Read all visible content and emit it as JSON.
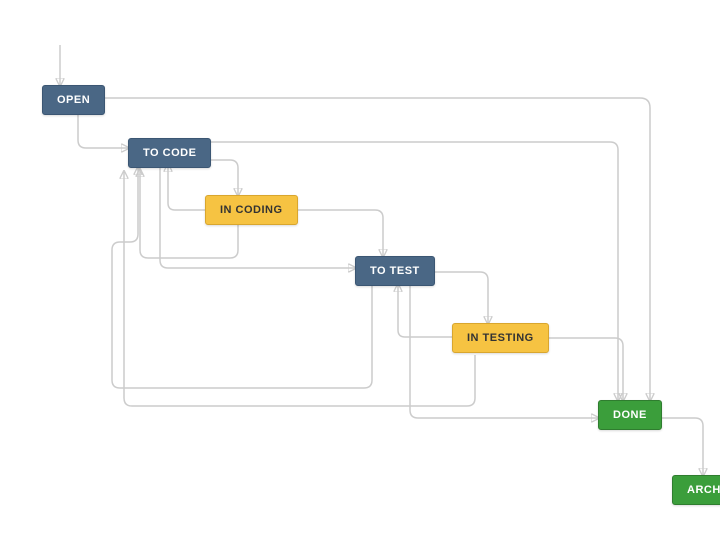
{
  "nodes": {
    "open": {
      "label": "OPEN",
      "type": "blue"
    },
    "to_code": {
      "label": "TO CODE",
      "type": "blue"
    },
    "in_coding": {
      "label": "IN CODING",
      "type": "yellow"
    },
    "to_test": {
      "label": "TO TEST",
      "type": "blue"
    },
    "in_testing": {
      "label": "IN TESTING",
      "type": "yellow"
    },
    "done": {
      "label": "DONE",
      "type": "green"
    },
    "archived": {
      "label": "ARCHI",
      "type": "green"
    }
  },
  "colors": {
    "blue": "#4a6785",
    "yellow": "#f6c342",
    "green": "#3b9e3b",
    "edge": "#cccccc"
  },
  "transitions": [
    [
      "open",
      "to_code"
    ],
    [
      "open",
      "done"
    ],
    [
      "to_code",
      "in_coding"
    ],
    [
      "to_code",
      "to_test"
    ],
    [
      "to_code",
      "done"
    ],
    [
      "in_coding",
      "to_code"
    ],
    [
      "in_coding",
      "to_test"
    ],
    [
      "to_test",
      "to_code"
    ],
    [
      "to_test",
      "in_testing"
    ],
    [
      "to_test",
      "done"
    ],
    [
      "in_testing",
      "to_test"
    ],
    [
      "in_testing",
      "to_code"
    ],
    [
      "in_testing",
      "done"
    ],
    [
      "done",
      "archived"
    ],
    [
      "done",
      "to_code"
    ]
  ]
}
